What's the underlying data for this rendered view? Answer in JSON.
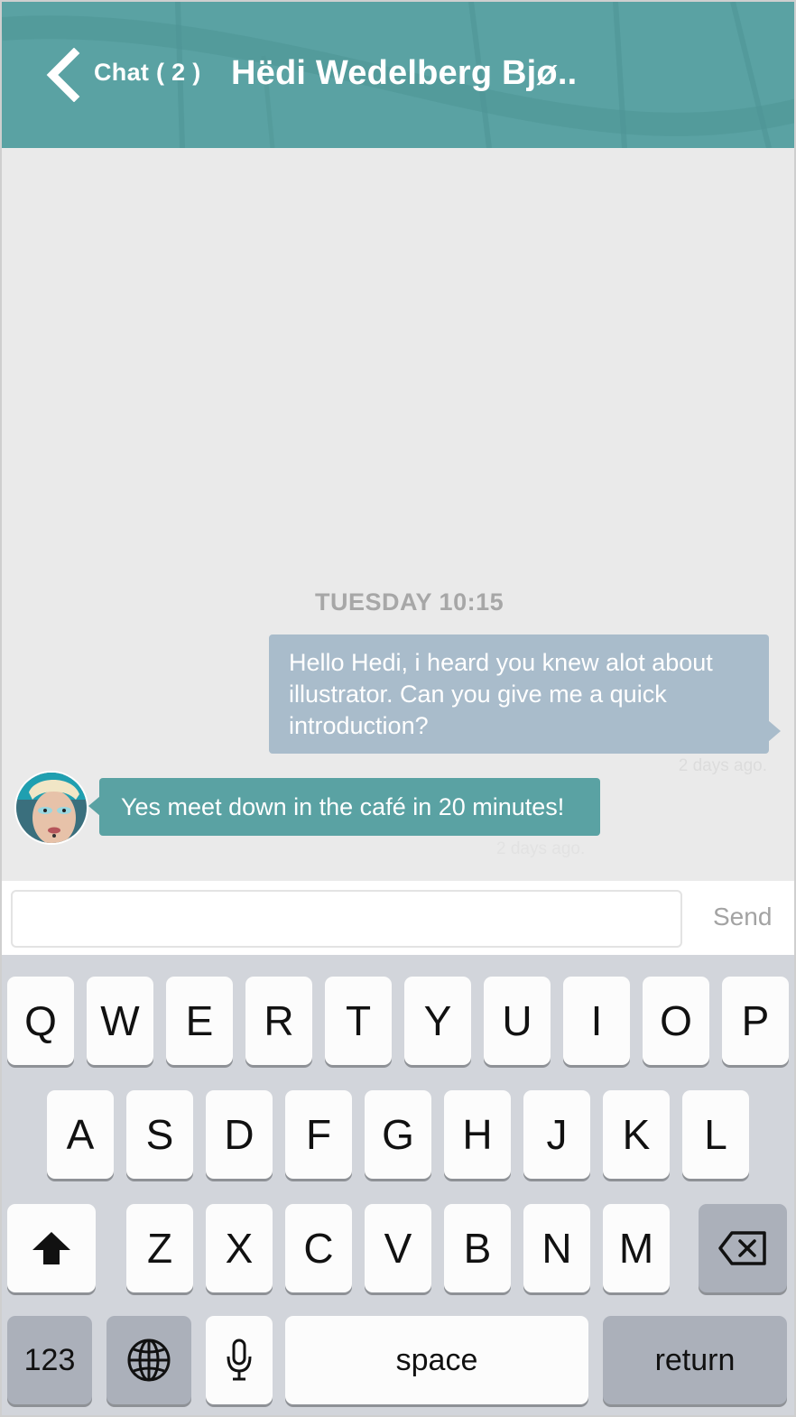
{
  "header": {
    "back_label": "Chat ( 2 )",
    "title": "Hëdi Wedelberg Bjø..",
    "background_color": "#5aa2a3"
  },
  "chat": {
    "day_stamp": "TUESDAY 10:15",
    "messages": [
      {
        "direction": "outgoing",
        "text": "Hello Hedi, i heard you knew alot about illustrator. Can you give me a quick introduction?",
        "time": "2 days ago.",
        "color": "#a9bccb"
      },
      {
        "direction": "incoming",
        "text": "Yes meet down in the café in 20 minutes!",
        "time": "2 days ago.",
        "color": "#5aa2a3"
      }
    ]
  },
  "composer": {
    "input_value": "",
    "placeholder": "",
    "send_label": "Send"
  },
  "keyboard": {
    "row1": [
      "Q",
      "W",
      "E",
      "R",
      "T",
      "Y",
      "U",
      "I",
      "O",
      "P"
    ],
    "row2": [
      "A",
      "S",
      "D",
      "F",
      "G",
      "H",
      "J",
      "K",
      "L"
    ],
    "row3": [
      "Z",
      "X",
      "C",
      "V",
      "B",
      "N",
      "M"
    ],
    "numbers_label": "123",
    "space_label": "space",
    "return_label": "return",
    "icons": {
      "shift": "shift-icon",
      "backspace": "backspace-icon",
      "globe": "globe-icon",
      "mic": "microphone-icon"
    }
  }
}
